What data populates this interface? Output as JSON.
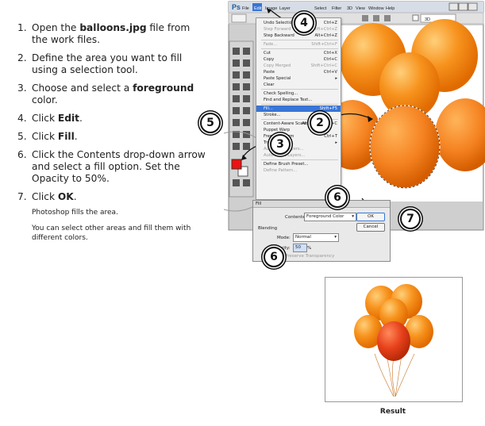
{
  "steps": [
    {
      "num": "1.",
      "pre": "Open the ",
      "bold": "balloons.jpg",
      "post": " file from the work files."
    },
    {
      "num": "2.",
      "pre": "Define the area you want to fill using a selection tool.",
      "bold": "",
      "post": ""
    },
    {
      "num": "3.",
      "pre": "Choose and select a ",
      "bold": "foreground",
      "post": " color."
    },
    {
      "num": "4.",
      "pre": "Click ",
      "bold": "Edit",
      "post": "."
    },
    {
      "num": "5.",
      "pre": "Click ",
      "bold": "Fill",
      "post": "."
    },
    {
      "num": "6.",
      "pre": "Click the Contents drop-down arrow and select a fill option. Set the Opacity to 50%.",
      "bold": "",
      "post": ""
    },
    {
      "num": "7.",
      "pre": "Click ",
      "bold": "OK",
      "post": "."
    }
  ],
  "notes": [
    "Photoshop fills the area.",
    "You can select other areas and fill them with different colors."
  ],
  "app": {
    "logo": "Ps",
    "menubar": [
      "File",
      "Edit",
      "Image",
      "Layer",
      "Select",
      "Filter",
      "3D",
      "View",
      "Window",
      "Help"
    ],
    "workspace": "3D"
  },
  "edit_menu": [
    {
      "label": "Undo Selection",
      "shortcut": "Ctrl+Z",
      "dim": false
    },
    {
      "label": "Step Forward",
      "shortcut": "Shift+Ctrl+Z",
      "dim": true
    },
    {
      "label": "Step Backward",
      "shortcut": "Alt+Ctrl+Z",
      "dim": false
    },
    {
      "sep": true
    },
    {
      "label": "Fade...",
      "shortcut": "Shift+Ctrl+F",
      "dim": true
    },
    {
      "sep": true
    },
    {
      "label": "Cut",
      "shortcut": "Ctrl+X",
      "dim": false
    },
    {
      "label": "Copy",
      "shortcut": "Ctrl+C",
      "dim": false
    },
    {
      "label": "Copy Merged",
      "shortcut": "Shift+Ctrl+C",
      "dim": true
    },
    {
      "label": "Paste",
      "shortcut": "Ctrl+V",
      "dim": false
    },
    {
      "label": "Paste Special",
      "shortcut": "▸",
      "dim": false
    },
    {
      "label": "Clear",
      "shortcut": "",
      "dim": false
    },
    {
      "sep": true
    },
    {
      "label": "Check Spelling...",
      "shortcut": "",
      "dim": false
    },
    {
      "label": "Find and Replace Text...",
      "shortcut": "",
      "dim": false
    },
    {
      "sep": true
    },
    {
      "label": "Fill...",
      "shortcut": "Shift+F5",
      "dim": false,
      "highlight": true
    },
    {
      "label": "Stroke...",
      "shortcut": "",
      "dim": false
    },
    {
      "sep": true
    },
    {
      "label": "Content-Aware Scale",
      "shortcut": "Alt+Shift+Ctrl+C",
      "dim": false
    },
    {
      "label": "Puppet Warp",
      "shortcut": "",
      "dim": false
    },
    {
      "label": "Free Transform",
      "shortcut": "Ctrl+T",
      "dim": false
    },
    {
      "label": "Transform",
      "shortcut": "▸",
      "dim": false
    },
    {
      "label": "Auto-Align Layers...",
      "shortcut": "",
      "dim": true
    },
    {
      "label": "Auto-Blend Layers...",
      "shortcut": "",
      "dim": true
    },
    {
      "sep": true
    },
    {
      "label": "Define Brush Preset...",
      "shortcut": "",
      "dim": false
    },
    {
      "label": "Define Pattern...",
      "shortcut": "",
      "dim": true
    }
  ],
  "fill_dialog": {
    "title": "Fill",
    "contents_label": "Contents:",
    "contents_value": "Foreground Color",
    "blending_label": "Blending",
    "mode_label": "Mode:",
    "mode_value": "Normal",
    "opacity_label": "Opacity:",
    "opacity_value": "50",
    "opacity_unit": "%",
    "preserve_label": "Preserve Transparency",
    "ok_label": "OK",
    "cancel_label": "Cancel"
  },
  "callouts": [
    "2",
    "3",
    "4",
    "5",
    "6",
    "6",
    "7"
  ],
  "caption": "Result",
  "colors": {
    "foreground": "#ee1111",
    "balloon": "#f7931e",
    "highlight": "#3875d7",
    "filled_balloon": "#e8421c"
  }
}
